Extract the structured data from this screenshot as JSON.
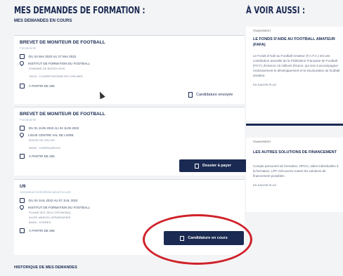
{
  "main": {
    "title": "MES DEMANDES DE FORMATION :",
    "current_heading": "MES DEMANDES EN COURS",
    "requests": [
      {
        "title": "BREVET DE MONITEUR DE FOOTBALL",
        "status": "Fonctionnel",
        "dates": "DU 24 MAI 2022 AU 27 MAI 2022",
        "institute": "INSTITUT DE FORMATION DU FOOTBALL",
        "institute_sub": "DOMAINE DE BOISSY-RIVE",
        "address": "78120 - CLAIREFONTAINE-EN-YVELINES",
        "price": "À PARTIR DE 20€",
        "action": "Candidature envoyée"
      },
      {
        "title": "BREVET DE MONITEUR DE FOOTBALL",
        "status": "Fonctionnel",
        "dates": "DU 01 JUIN 2022 AU 04 JUIN 2022",
        "institute": "LIGUE CENTRE VAL DE LOIRE",
        "institute_sub": "ROUTE DE VELLES",
        "address": "36000 - CHATEAUROUX",
        "price": "À PARTIR DE 20€",
        "action": "Dossier à payer"
      },
      {
        "title": "U9",
        "status": "Animateur/Arbitre/Éducateur/Accueil",
        "dates": "DU 04 JUIL 2022 AU 07 JUIL 2022",
        "institute": "INSTITUT DE FORMATION DU FOOTBALL",
        "institute_sub": "PLAINE DES JEUX SITE/MONIQ",
        "institute_sub2": "ALLÉE MARCEL DEPARDAPIER",
        "address": "83400 - HYERES",
        "price": "À PARTIR DE 20€",
        "action": "Candidature en cours"
      }
    ],
    "history_heading": "HISTORIQUE DE MES DEMANDES"
  },
  "side": {
    "title": "À VOIR AUSSI :",
    "cards": [
      {
        "tag": "FINANCEMENT",
        "title_line1": "LE FONDS D'AIDE AU FOOTBALL AMATEUR",
        "title_line2": "(FAFA)",
        "body": "Le Fonds d'Aide au Football Amateur (F.A.F.A.) est une contribution annuelle de la Fédération Française de Football (F.F.F.) d'environ 15 millions d'euros, qui vise à accompagner exclusivement le développement et la structuration du football amateur.",
        "link": "EN SAVOIR PLUS"
      },
      {
        "tag": "FINANCEMENT",
        "title_line1": "LES AUTRES SOLUTIONS DE FINANCEMENT",
        "body": "Compte personnel de formation, OPCO, aides individuelles à la formation, LPF. Découvrez toutes les solutions de financement possibles.",
        "link": "EN SAVOIR PLUS"
      }
    ]
  },
  "colors": {
    "navy": "#1a2a52",
    "highlight": "#d02028"
  }
}
